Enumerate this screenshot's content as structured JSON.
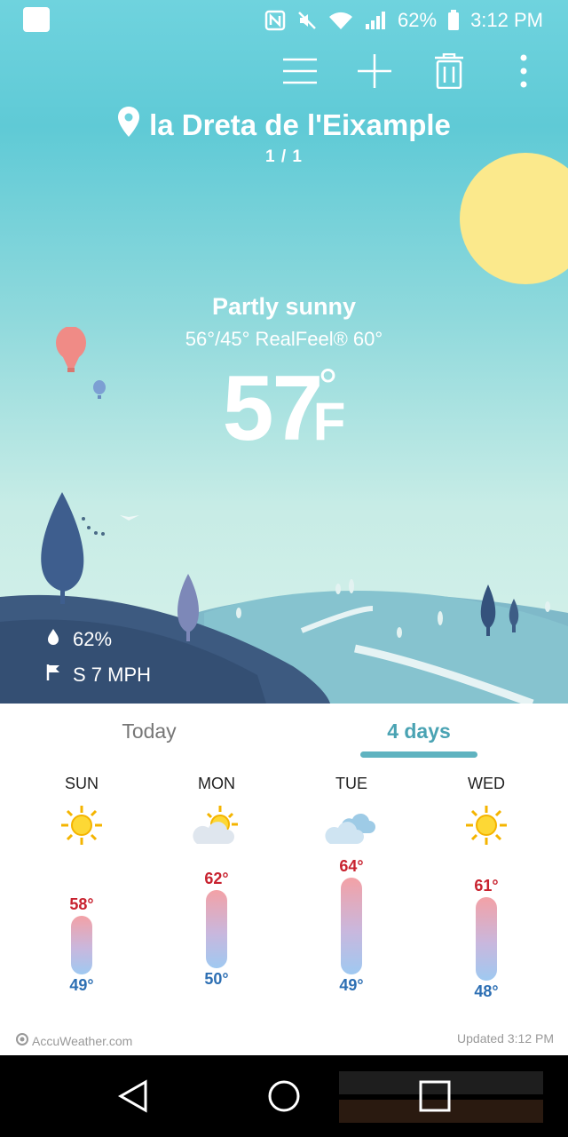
{
  "status_bar": {
    "battery": "62%",
    "time": "3:12 PM",
    "icons": [
      "nfc-icon",
      "mute-icon",
      "wifi-icon",
      "signal-icon",
      "battery-icon"
    ]
  },
  "toolbar": {
    "icons": [
      "menu-icon",
      "add-icon",
      "delete-icon",
      "more-icon"
    ]
  },
  "location": {
    "name": "la Dreta de l'Eixample",
    "page": "1 / 1"
  },
  "current": {
    "condition": "Partly sunny",
    "hilo_realfeel": "56°/45° RealFeel® 60°",
    "temperature": "57",
    "degree": "°",
    "unit": "F",
    "humidity": "62%",
    "wind": "S 7 MPH"
  },
  "tabs": {
    "today": "Today",
    "four_days": "4 days",
    "active": "4 days"
  },
  "forecast": [
    {
      "day": "SUN",
      "icon": "sunny-icon",
      "high": "58°",
      "low": "49°",
      "high_value": 58,
      "low_value": 49
    },
    {
      "day": "MON",
      "icon": "partly-sunny-icon",
      "high": "62°",
      "low": "50°",
      "high_value": 62,
      "low_value": 50
    },
    {
      "day": "TUE",
      "icon": "cloudy-icon",
      "high": "64°",
      "low": "49°",
      "high_value": 64,
      "low_value": 49
    },
    {
      "day": "WED",
      "icon": "sunny-icon",
      "high": "61°",
      "low": "48°",
      "high_value": 61,
      "low_value": 48
    }
  ],
  "footer": {
    "brand": "AccuWeather.com",
    "updated": "Updated 3:12 PM"
  },
  "colors": {
    "accent": "#5fb3c0",
    "high_temp": "#c8222f",
    "low_temp": "#2d6fb3",
    "sun": "#fbe98c",
    "sky_top": "#6fd3de"
  }
}
